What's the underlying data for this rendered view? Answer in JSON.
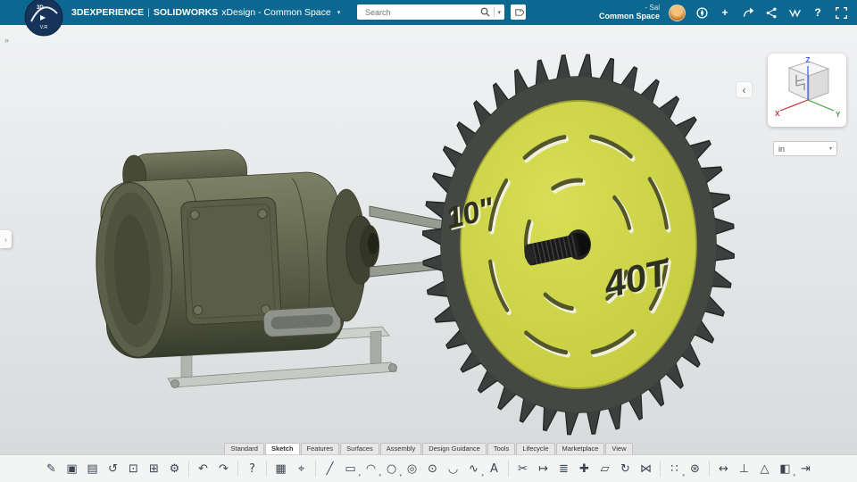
{
  "header": {
    "brand_bold": "3DEXPERIENCE",
    "brand_sep": "|",
    "brand_solidworks": "SOLIDWORKS",
    "app_title": "xDesign - Common Space",
    "caret": "▾",
    "search_placeholder": "Search",
    "user_name": "- Sal",
    "workspace": "Common Space",
    "logo_badge_top": "3D",
    "logo_badge_play": "▶",
    "logo_badge_bottom": "V.R",
    "icon_names": [
      "tag-icon",
      "compass-icon",
      "add-icon",
      "share-icon",
      "collaborate-icon",
      "assistant-icon",
      "help-icon",
      "fullscreen-icon"
    ]
  },
  "viewport": {
    "units": "in",
    "units_caret": "▾",
    "collapse_left": "‹",
    "panel_expand_top": "»",
    "panel_expand_mid": "›",
    "axis_x": "X",
    "axis_y": "Y",
    "axis_z": "Z"
  },
  "model": {
    "blade_size_label": "10\"",
    "blade_teeth_label": "40T"
  },
  "ribbon": {
    "tabs": [
      {
        "label": "Standard",
        "active": false
      },
      {
        "label": "Sketch",
        "active": true
      },
      {
        "label": "Features",
        "active": false
      },
      {
        "label": "Surfaces",
        "active": false
      },
      {
        "label": "Assembly",
        "active": false
      },
      {
        "label": "Design Guidance",
        "active": false
      },
      {
        "label": "Tools",
        "active": false
      },
      {
        "label": "Lifecycle",
        "active": false
      },
      {
        "label": "Marketplace",
        "active": false
      },
      {
        "label": "View",
        "active": false
      }
    ]
  },
  "toolbar": {
    "groups": [
      [
        {
          "name": "sketch",
          "glyph": "✎"
        },
        {
          "name": "convert-entities",
          "glyph": "▣"
        },
        {
          "name": "save",
          "glyph": "▤"
        },
        {
          "name": "update",
          "glyph": "↺"
        },
        {
          "name": "image",
          "glyph": "⊡"
        },
        {
          "name": "instances",
          "glyph": "⊞"
        },
        {
          "name": "settings",
          "glyph": "⚙"
        }
      ],
      [
        {
          "name": "undo",
          "glyph": "↶"
        },
        {
          "name": "redo",
          "glyph": "↷"
        }
      ],
      [
        {
          "name": "help",
          "glyph": "?"
        }
      ],
      [
        {
          "name": "grid",
          "glyph": "▦"
        },
        {
          "name": "evaluate",
          "glyph": "⌖"
        }
      ],
      [
        {
          "name": "line",
          "glyph": "╱"
        },
        {
          "name": "rectangle",
          "glyph": "▭",
          "caret": true
        },
        {
          "name": "arc",
          "glyph": "◠",
          "caret": true
        },
        {
          "name": "circle",
          "glyph": "○",
          "caret": true
        },
        {
          "name": "perimeter-circle",
          "glyph": "◎"
        },
        {
          "name": "ellipse",
          "glyph": "⊙"
        },
        {
          "name": "conic",
          "glyph": "◡"
        },
        {
          "name": "spline",
          "glyph": "∿",
          "caret": true
        },
        {
          "name": "text",
          "glyph": "A"
        }
      ],
      [
        {
          "name": "trim",
          "glyph": "✂"
        },
        {
          "name": "extend",
          "glyph": "↦"
        },
        {
          "name": "offset",
          "glyph": "≣"
        },
        {
          "name": "move",
          "glyph": "✚"
        },
        {
          "name": "copy",
          "glyph": "▱"
        },
        {
          "name": "rotate",
          "glyph": "↻"
        },
        {
          "name": "mirror",
          "glyph": "⋈"
        }
      ],
      [
        {
          "name": "linear-pattern",
          "glyph": "∷",
          "caret": true
        },
        {
          "name": "circular-pattern",
          "glyph": "⊛"
        }
      ],
      [
        {
          "name": "smart-dimension",
          "glyph": "↔"
        },
        {
          "name": "constraints",
          "glyph": "⊥"
        },
        {
          "name": "reference",
          "glyph": "△"
        },
        {
          "name": "primitives",
          "glyph": "◧",
          "caret": true
        },
        {
          "name": "export",
          "glyph": "⇥"
        }
      ]
    ]
  }
}
